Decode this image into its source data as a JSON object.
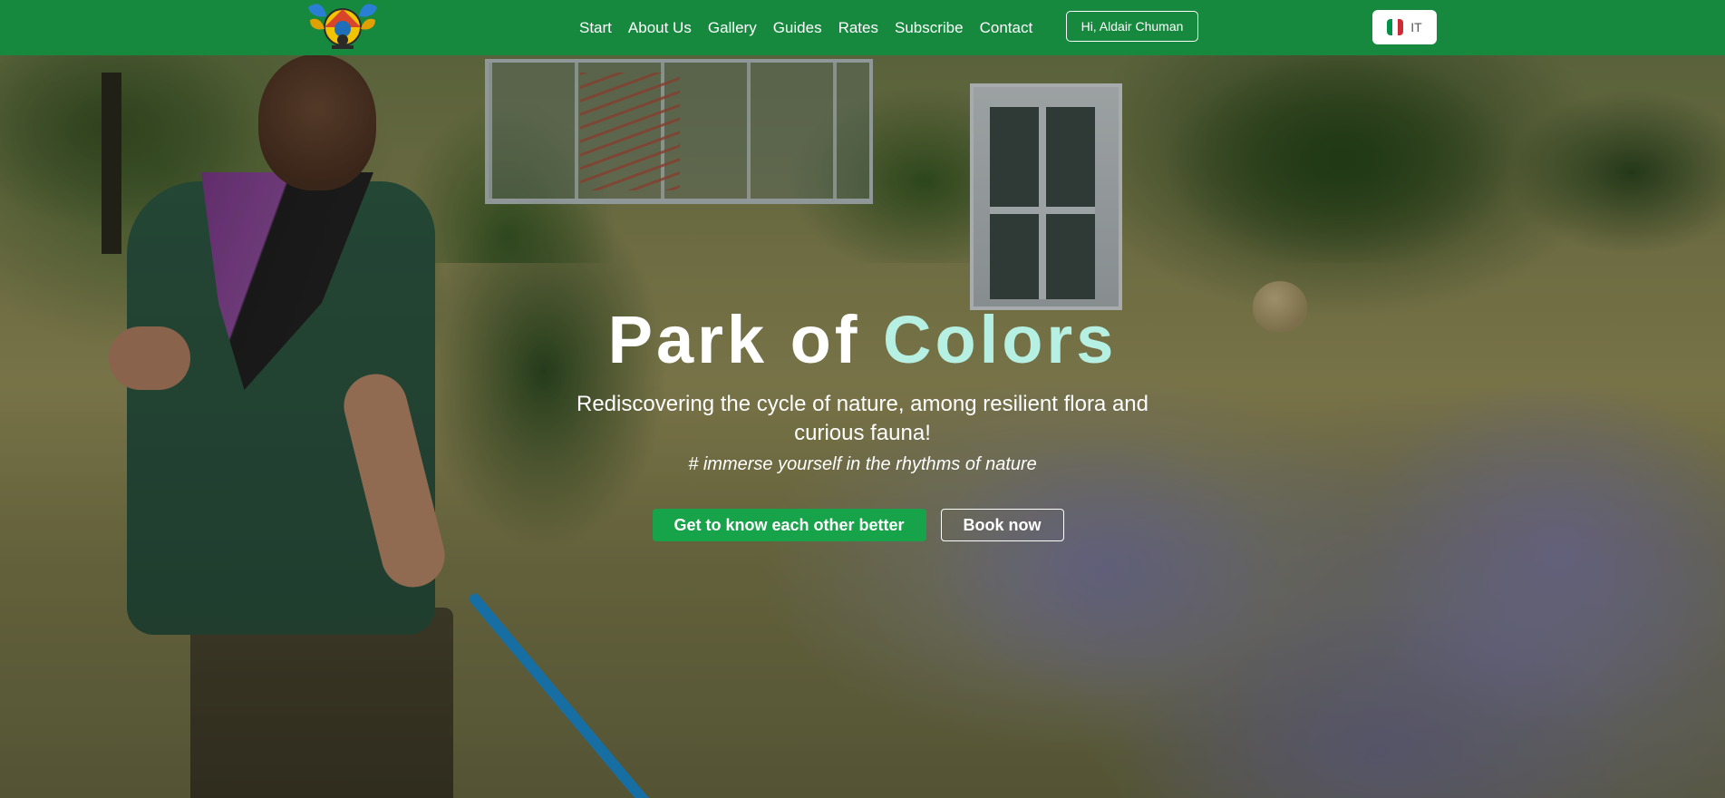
{
  "nav": {
    "links": [
      {
        "label": "Start"
      },
      {
        "label": "About Us"
      },
      {
        "label": "Gallery"
      },
      {
        "label": "Guides"
      },
      {
        "label": "Rates"
      },
      {
        "label": "Subscribe"
      },
      {
        "label": "Contact"
      }
    ],
    "user_button": "Hi, Aldair Chuman",
    "language": {
      "code": "IT",
      "icon": "italy-flag-icon"
    }
  },
  "hero": {
    "title_part1": "Park of",
    "title_part2": "Colors",
    "subtitle": "Rediscovering the cycle of nature, among resilient flora and curious fauna!",
    "tagline": "# immerse yourself in the rhythms of nature",
    "primary_button": "Get to know each other better",
    "secondary_button": "Book now"
  },
  "colors": {
    "navbar": "#17893f",
    "accent_title": "#b6f0e3",
    "primary_button": "#17a349"
  }
}
